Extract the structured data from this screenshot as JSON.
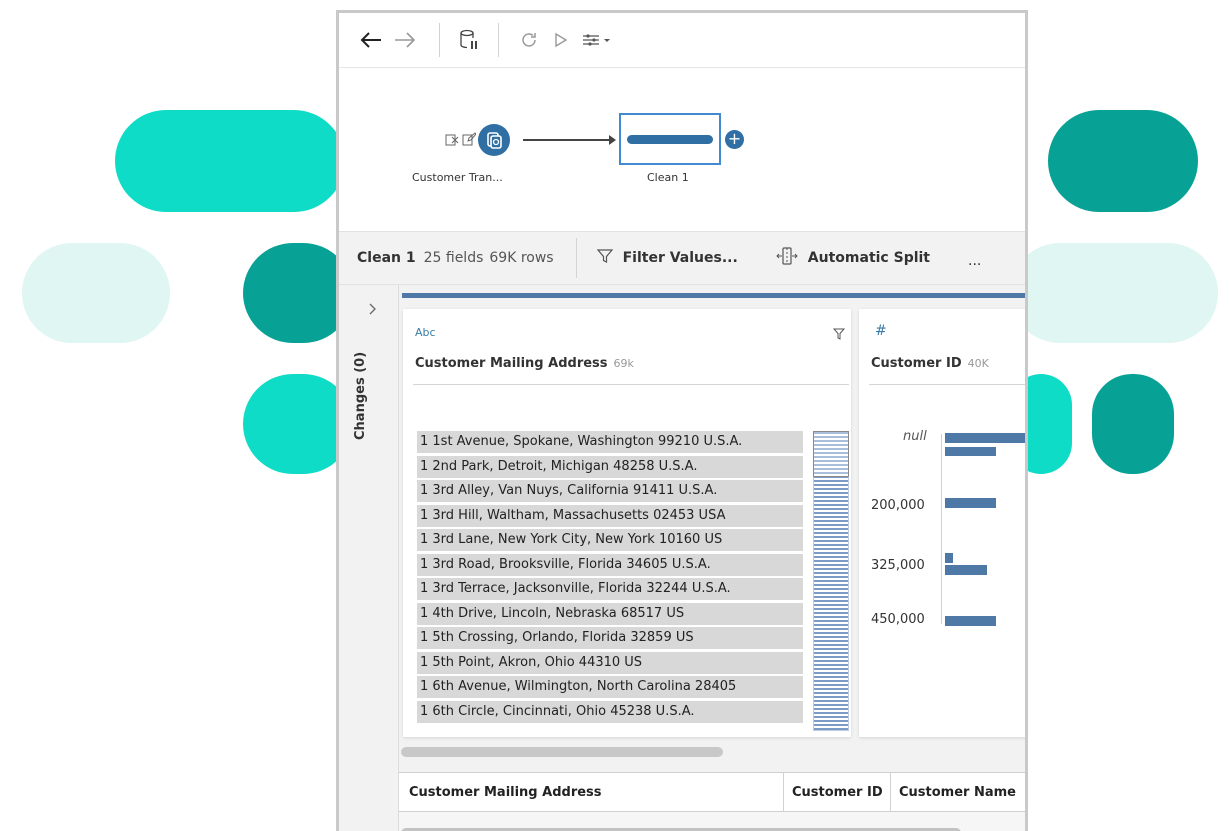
{
  "colors": {
    "accent_teal": "#0fdcc6",
    "dark_teal": "#07a195",
    "pale_teal": "#dff6f2",
    "tableau_blue": "#4e79a7",
    "node_blue": "#2f6fa3"
  },
  "toolbar": {
    "icons": [
      "back-arrow-icon",
      "forward-arrow-icon",
      "pause-data-updates-icon",
      "refresh-icon",
      "run-flow-icon",
      "options-icon"
    ]
  },
  "flow": {
    "input_node_label": "Customer Tran...",
    "clean_node_label": "Clean 1"
  },
  "stepbar": {
    "step_name": "Clean 1",
    "fields": "25 fields",
    "rows": "69K rows",
    "filter_label": "Filter Values...",
    "split_label": "Automatic Split",
    "more_label": "..."
  },
  "sidebar": {
    "changes_label": "Changes (0)"
  },
  "profile": {
    "address_card": {
      "type_label": "Abc",
      "title": "Customer Mailing Address",
      "count": "69k",
      "values": [
        "1 1st Avenue, Spokane, Washington 99210 U.S.A.",
        "1 2nd Park, Detroit, Michigan 48258 U.S.A.",
        "1 3rd Alley, Van Nuys, California 91411 U.S.A.",
        "1 3rd Hill, Waltham, Massachusetts 02453 USA",
        "1 3rd Lane, New York City, New York 10160 US",
        "1 3rd Road, Brooksville, Florida 34605 U.S.A.",
        "1 3rd Terrace, Jacksonville, Florida 32244 U.S.A.",
        "1 4th Drive, Lincoln, Nebraska 68517 US",
        "1 5th Crossing, Orlando, Florida 32859 US",
        "1 5th Point, Akron, Ohio 44310 US",
        "1 6th Avenue, Wilmington, North Carolina 28405",
        "1 6th Circle, Cincinnati, Ohio 45238 U.S.A."
      ]
    },
    "id_card": {
      "type_label": "#",
      "title": "Customer ID",
      "count": "40K",
      "axis_labels": [
        "null",
        "200,000",
        "325,000",
        "450,000"
      ]
    }
  },
  "grid": {
    "columns": [
      "Customer Mailing Address",
      "Customer ID",
      "Customer Name"
    ]
  }
}
